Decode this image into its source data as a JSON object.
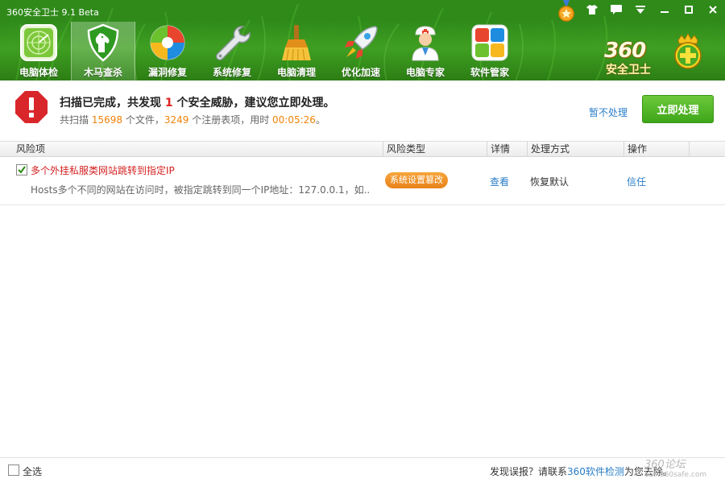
{
  "app_title": "360安全卫士 9.1 Beta",
  "brand": {
    "logo_number": "360",
    "logo_text": "安全卫士"
  },
  "nav": [
    {
      "label": "电脑体检",
      "icon": "radar-icon"
    },
    {
      "label": "木马查杀",
      "icon": "horse-shield-icon",
      "active": true
    },
    {
      "label": "漏洞修复",
      "icon": "windows-patch-icon"
    },
    {
      "label": "系统修复",
      "icon": "wrench-icon"
    },
    {
      "label": "电脑清理",
      "icon": "broom-icon"
    },
    {
      "label": "优化加速",
      "icon": "rocket-icon"
    },
    {
      "label": "电脑专家",
      "icon": "doctor-icon"
    },
    {
      "label": "软件管家",
      "icon": "app-grid-icon"
    }
  ],
  "result": {
    "title_prefix": "扫描已完成，共发现 ",
    "threat_count": "1",
    "title_suffix": " 个安全威胁，建议您立即处理。",
    "scan_prefix": "共扫描 ",
    "files": "15698",
    "files_unit": " 个文件，",
    "registry": "3249",
    "registry_unit": " 个注册表项，用时 ",
    "duration": "00:05:26",
    "duration_end": "。",
    "ignore_label": "暂不处理",
    "fix_label": "立即处理"
  },
  "table": {
    "headers": [
      "风险项",
      "风险类型",
      "详情",
      "处理方式",
      "操作"
    ],
    "rows": [
      {
        "checked": true,
        "name": "多个外挂私服类网站跳转到指定IP",
        "description": "Hosts多个不同的网站在访问时，被指定跳转到同一个IP地址：127.0.0.1，如...",
        "type": "系统设置篡改",
        "detail": "查看",
        "method": "恢复默认",
        "action": "信任"
      }
    ]
  },
  "footer": {
    "select_all": "全选",
    "report_prefix": "发现误报？请联系",
    "report_link": "360软件检测",
    "report_suffix": "为您去除。",
    "watermark_top": "360论坛",
    "watermark_bottom": "bbs.360safe.com"
  },
  "colors": {
    "header_green": "#2f8a1a",
    "primary_button": "#4cb026",
    "danger": "#e02020",
    "link": "#2a7ec8",
    "badge": "#ee8a22"
  }
}
